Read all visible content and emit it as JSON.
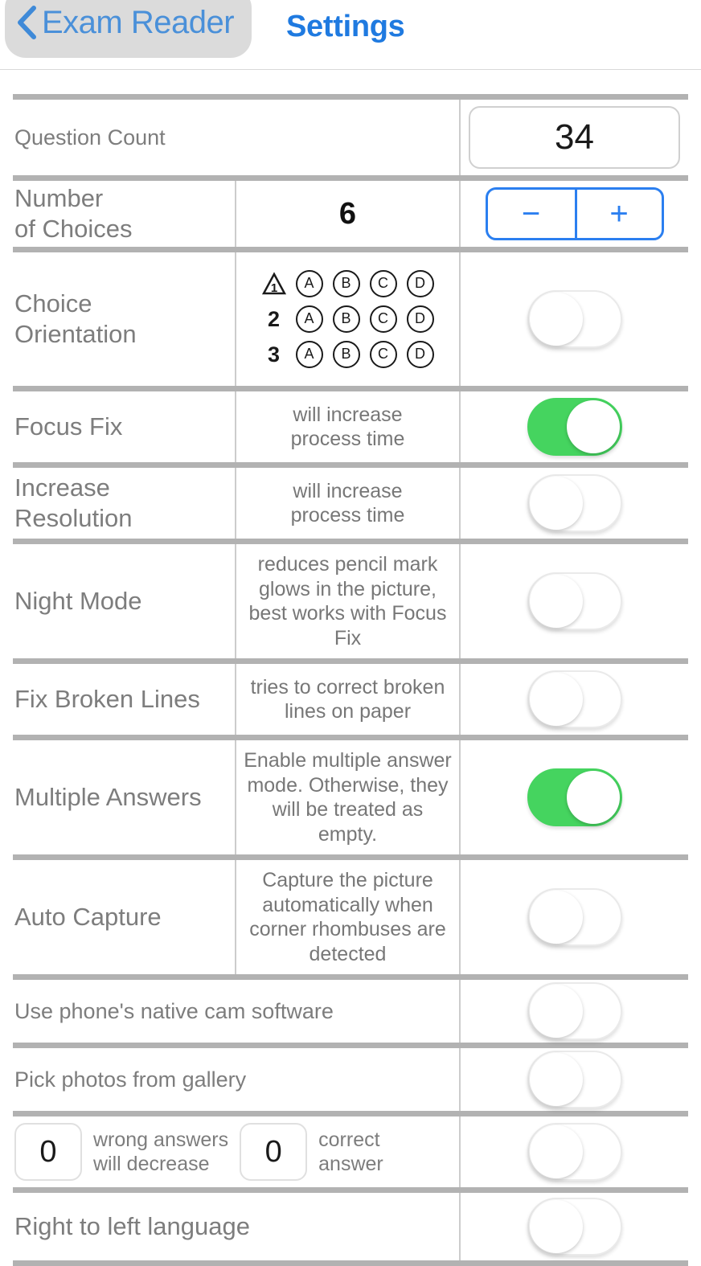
{
  "navbar": {
    "back_label": "Exam Reader",
    "back_icon": "chevron-left-icon",
    "title": "Settings"
  },
  "settings": {
    "question_count": {
      "label": "Question Count",
      "value": "34"
    },
    "number_of_choices": {
      "label": "Number\nof Choices",
      "value": "6",
      "minus_label": "−",
      "plus_label": "+"
    },
    "choice_orientation": {
      "label": "Choice\nOrientation",
      "rows": [
        {
          "num": "1",
          "bubbles": [
            "A",
            "B",
            "C",
            "D"
          ]
        },
        {
          "num": "2",
          "bubbles": [
            "A",
            "B",
            "C",
            "D"
          ]
        },
        {
          "num": "3",
          "bubbles": [
            "A",
            "B",
            "C",
            "D"
          ]
        }
      ],
      "toggle": "off"
    },
    "focus_fix": {
      "label": "Focus Fix",
      "description": "will increase\nprocess time",
      "toggle": "on"
    },
    "increase_resolution": {
      "label": "Increase\nResolution",
      "description": "will increase\nprocess time",
      "toggle": "off"
    },
    "night_mode": {
      "label": "Night Mode",
      "description": "reduces pencil mark glows in the picture, best works with Focus Fix",
      "toggle": "off"
    },
    "fix_broken_lines": {
      "label": "Fix Broken Lines",
      "description": "tries to correct broken lines on paper",
      "toggle": "off"
    },
    "multiple_answers": {
      "label": "Multiple Answers",
      "description": "Enable multiple answer mode. Otherwise, they will be treated as empty.",
      "toggle": "on"
    },
    "auto_capture": {
      "label": "Auto Capture",
      "description": "Capture the picture automatically when corner rhombuses are detected",
      "toggle": "off"
    },
    "native_cam": {
      "label": "Use phone's native cam software",
      "toggle": "off"
    },
    "pick_gallery": {
      "label": "Pick photos from gallery",
      "toggle": "off"
    },
    "scoring": {
      "wrong_value": "0",
      "wrong_label": "wrong answers\nwill decrease",
      "correct_value": "0",
      "correct_label": "correct\nanswer",
      "toggle": "off"
    },
    "rtl_language": {
      "label": "Right to left language",
      "toggle": "off"
    }
  },
  "colors": {
    "toggle_on": "#45d45f",
    "accent_blue": "#2b7ff0",
    "nav_blue": "#1f7ae0",
    "label_gray": "#7d7d7d",
    "separator": "#b2b2b2"
  }
}
